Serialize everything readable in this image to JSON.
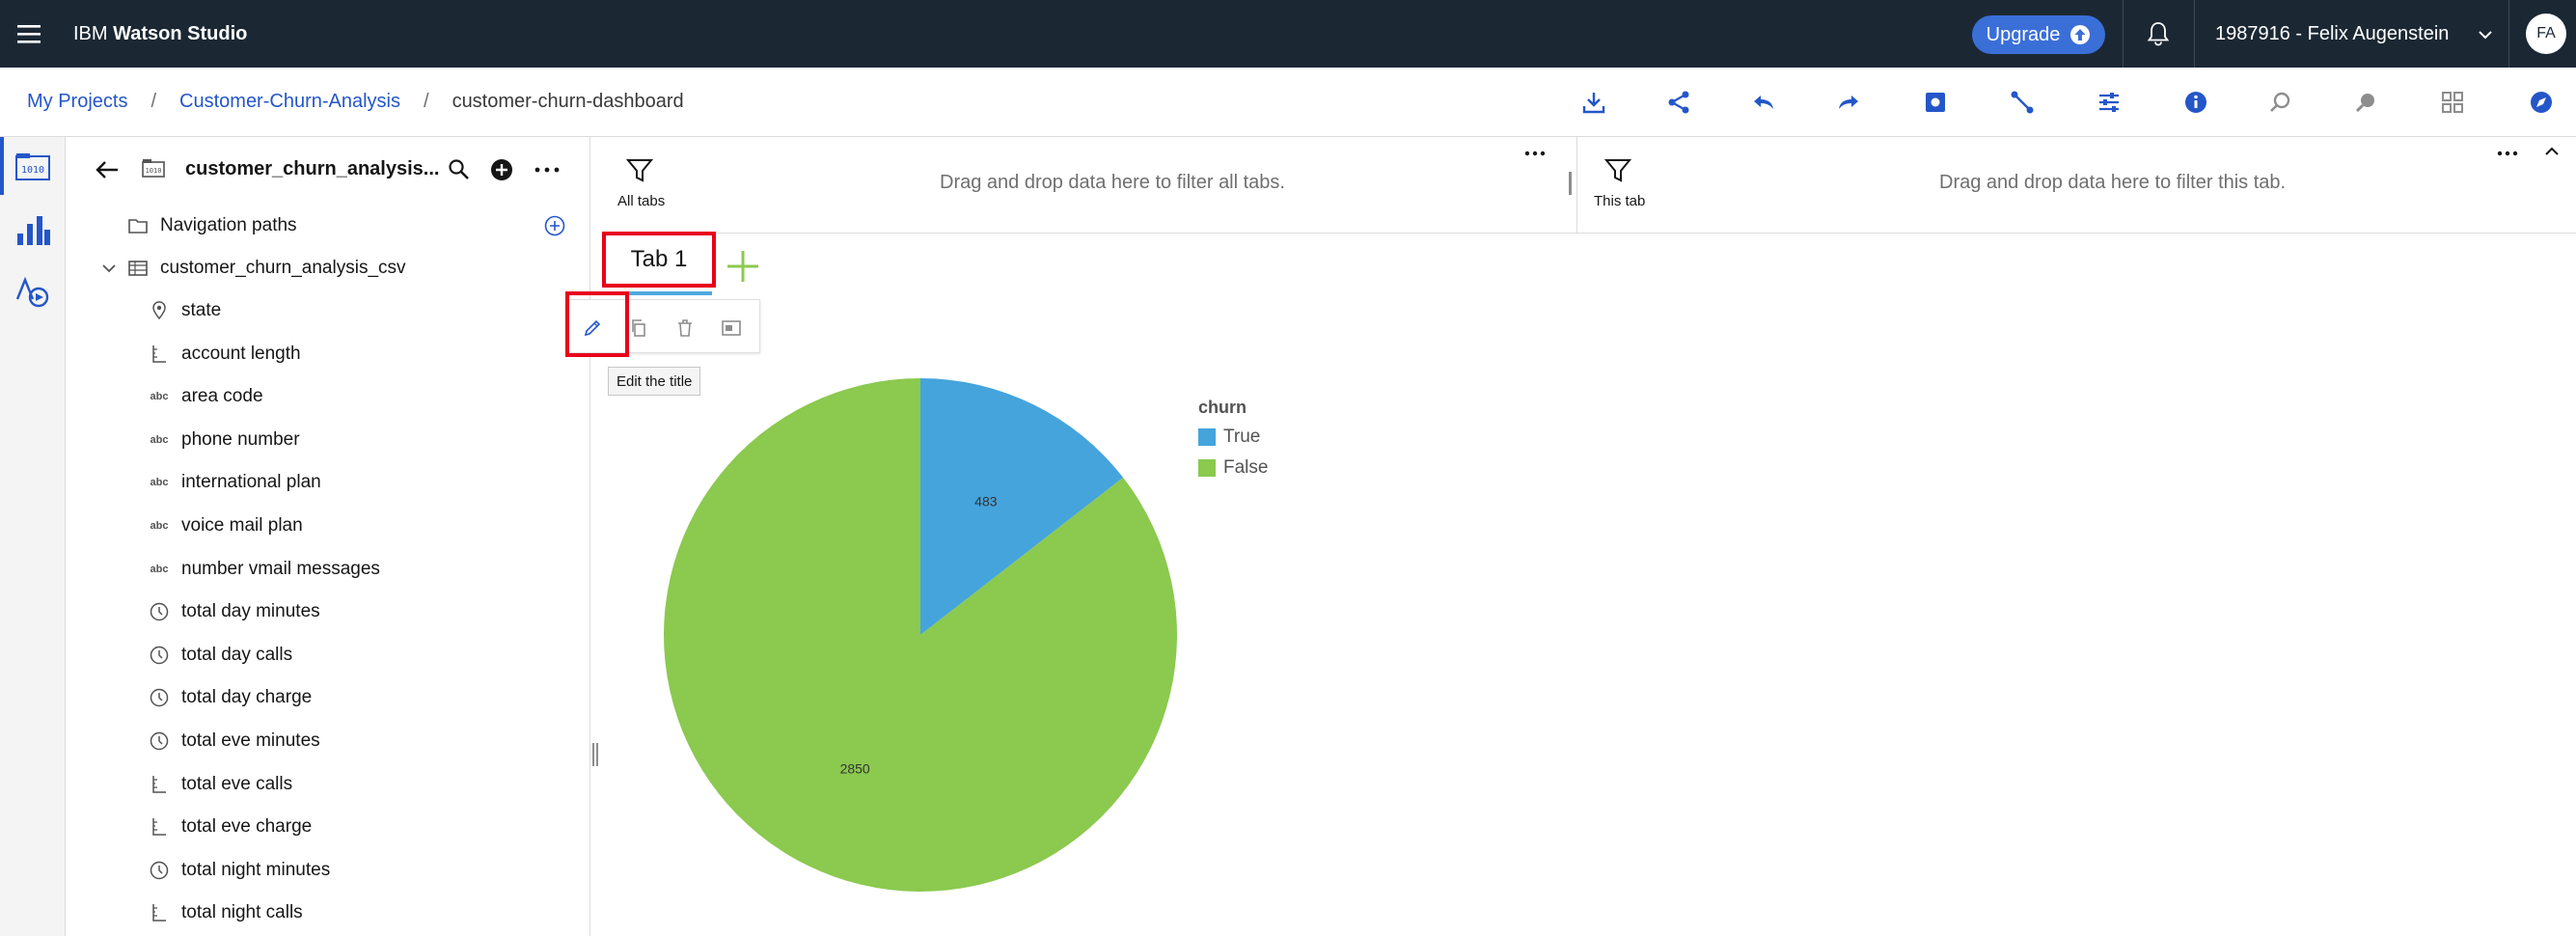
{
  "topbar": {
    "brand_prefix": "IBM",
    "brand_name": "Watson Studio",
    "upgrade_label": "Upgrade",
    "account": "1987916 - Felix Augenstein",
    "avatar_initials": "FA"
  },
  "breadcrumb": {
    "items": [
      "My Projects",
      "Customer-Churn-Analysis",
      "customer-churn-dashboard"
    ],
    "separator": "/"
  },
  "panel": {
    "title": "customer_churn_analysis...",
    "navigation_paths": "Navigation paths",
    "table": "customer_churn_analysis_csv",
    "columns": [
      {
        "label": "state",
        "icon": "location-icon"
      },
      {
        "label": "account length",
        "icon": "measure-icon"
      },
      {
        "label": "area code",
        "icon": "abc",
        "abc": "abc"
      },
      {
        "label": "phone number",
        "icon": "abc",
        "abc": "abc"
      },
      {
        "label": "international plan",
        "icon": "abc",
        "abc": "abc"
      },
      {
        "label": "voice mail plan",
        "icon": "abc",
        "abc": "abc"
      },
      {
        "label": "number vmail messages",
        "icon": "abc",
        "abc": "abc"
      },
      {
        "label": "total day minutes",
        "icon": "time-icon"
      },
      {
        "label": "total day calls",
        "icon": "time-icon"
      },
      {
        "label": "total day charge",
        "icon": "time-icon"
      },
      {
        "label": "total eve minutes",
        "icon": "time-icon"
      },
      {
        "label": "total eve calls",
        "icon": "measure-icon"
      },
      {
        "label": "total eve charge",
        "icon": "measure-icon"
      },
      {
        "label": "total night minutes",
        "icon": "time-icon"
      },
      {
        "label": "total night calls",
        "icon": "measure-icon"
      }
    ]
  },
  "filters": {
    "all_tabs_label": "All tabs",
    "all_tabs_msg": "Drag and drop data here to filter all tabs.",
    "this_tab_label": "This tab",
    "this_tab_msg": "Drag and drop data here to filter this tab."
  },
  "tabs": {
    "tab1": "Tab 1"
  },
  "tooltip": "Edit the title",
  "colors": {
    "topbar": "#1b2834",
    "link": "#2456c9",
    "highlight": "#e8001c",
    "true": "#45a4dc",
    "false": "#8bc94f"
  },
  "chart_data": {
    "type": "pie",
    "legend_title": "churn",
    "legend_position": "right",
    "slices": [
      {
        "name": "True",
        "value": 483,
        "color": "#45a4dc"
      },
      {
        "name": "False",
        "value": 2850,
        "color": "#8bc94f"
      }
    ]
  }
}
